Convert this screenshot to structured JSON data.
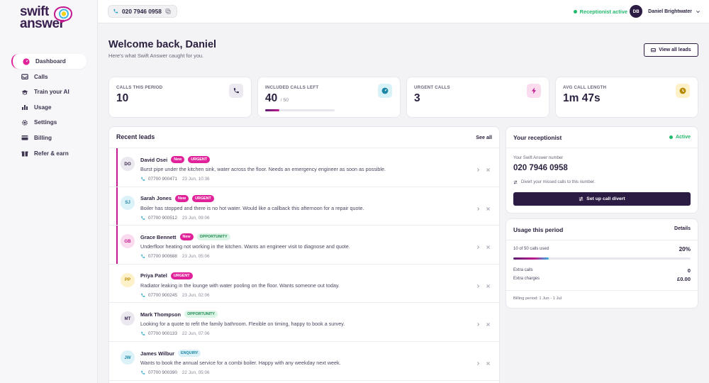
{
  "brand": {
    "line1": "swift",
    "line2": "answer"
  },
  "sidebar": {
    "items": [
      {
        "label": "Dashboard",
        "icon": "dashboard-icon",
        "active": true
      },
      {
        "label": "Calls",
        "icon": "inbox-icon"
      },
      {
        "label": "Train your AI",
        "icon": "graduation-cap-icon"
      },
      {
        "label": "Usage",
        "icon": "bar-chart-icon"
      },
      {
        "label": "Settings",
        "icon": "gear-icon"
      },
      {
        "label": "Billing",
        "icon": "credit-card-icon"
      },
      {
        "label": "Refer & earn",
        "icon": "gift-icon"
      }
    ]
  },
  "topbar": {
    "phone": "020 7946 0958",
    "status": "Receptionist active",
    "user_initials": "DB",
    "user_name": "Daniel Brightwater"
  },
  "header": {
    "title": "Welcome back, Daniel",
    "subtitle": "Here's what Swift Answer caught for you.",
    "view_all": "View all leads"
  },
  "stats": [
    {
      "label": "CALLS THIS PERIOD",
      "value": "10",
      "icon": "phone-icon",
      "icon_bg": "#ece9f0",
      "icon_color": "#3a2a52"
    },
    {
      "label": "INCLUDED CALLS LEFT",
      "value": "40",
      "suffix": "/ 50",
      "icon": "gauge-icon",
      "icon_bg": "#d9f2f8",
      "icon_color": "#1d86a6",
      "progress": 0.2
    },
    {
      "label": "URGENT CALLS",
      "value": "3",
      "icon": "bolt-icon",
      "icon_bg": "#fbdcef",
      "icon_color": "#c21a8e"
    },
    {
      "label": "AVG CALL LENGTH",
      "value": "1m 47s",
      "icon": "clock-icon",
      "icon_bg": "#fcf1c9",
      "icon_color": "#b58a00"
    }
  ],
  "leads": {
    "title": "Recent leads",
    "see_all": "See all",
    "items": [
      {
        "initials": "DO",
        "name": "David Osei",
        "badges": [
          "New",
          "URGENT"
        ],
        "message": "Burst pipe under the kitchen sink, water across the floor. Needs an emergency engineer as soon as possible.",
        "phone": "07700 900471",
        "time": "23 Jun, 10:36",
        "avatar_bg": "#ebe8ef",
        "avatar_color": "#3a2a52",
        "highlight": true
      },
      {
        "initials": "SJ",
        "name": "Sarah Jones",
        "badges": [
          "New",
          "URGENT"
        ],
        "message": "Boiler has stopped and there is no hot water. Would like a callback this afternoon for a repair quote.",
        "phone": "07700 900512",
        "time": "23 Jun, 09:06",
        "avatar_bg": "#dcf2f9",
        "avatar_color": "#1d86a6",
        "highlight": true
      },
      {
        "initials": "GB",
        "name": "Grace Bennett",
        "badges": [
          "New",
          "OPPORTUNITY"
        ],
        "message": "Underfloor heating not working in the kitchen. Wants an engineer visit to diagnose and quote.",
        "phone": "07700 900688",
        "time": "23 Jun, 05:06",
        "avatar_bg": "#fbdcef",
        "avatar_color": "#c21a8e",
        "highlight": true
      },
      {
        "initials": "PP",
        "name": "Priya Patel",
        "badges": [
          "URGENT"
        ],
        "message": "Radiator leaking in the lounge with water pooling on the floor. Wants someone out today.",
        "phone": "07700 900245",
        "time": "23 Jun, 02:06",
        "avatar_bg": "#fcf1c9",
        "avatar_color": "#b58a00",
        "highlight": false
      },
      {
        "initials": "MT",
        "name": "Mark Thompson",
        "badges": [
          "OPPORTUNITY"
        ],
        "message": "Looking for a quote to refit the family bathroom. Flexible on timing, happy to book a survey.",
        "phone": "07700 900133",
        "time": "22 Jun, 07:06",
        "avatar_bg": "#ebe8ef",
        "avatar_color": "#3a2a52",
        "highlight": false
      },
      {
        "initials": "JW",
        "name": "James Wilbur",
        "badges": [
          "ENQUIRY"
        ],
        "message": "Wants to book the annual service for a combi boiler. Happy with any weekday next week.",
        "phone": "07700 900390",
        "time": "22 Jun, 05:06",
        "avatar_bg": "#dcf2f9",
        "avatar_color": "#1d86a6",
        "highlight": false
      }
    ]
  },
  "receptionist": {
    "title": "Your receptionist",
    "status": "Active",
    "number_label": "Your Swift Answer number",
    "number": "020 7946 0958",
    "divert_text": "Divert your missed calls to this number.",
    "button": "Set up call divert"
  },
  "usage": {
    "title": "Usage this period",
    "details": "Details",
    "used_text": "10 of 50 calls used",
    "percent": "20%",
    "progress": 0.2,
    "extra_calls_label": "Extra calls",
    "extra_calls": "0",
    "extra_charges_label": "Extra charges",
    "extra_charges": "£0.00",
    "billing_period": "Billing period: 1 Jun - 1 Jul"
  },
  "colors": {
    "accent": "#e0219a",
    "brand_dark": "#2c1b42",
    "success": "#21b86b"
  }
}
